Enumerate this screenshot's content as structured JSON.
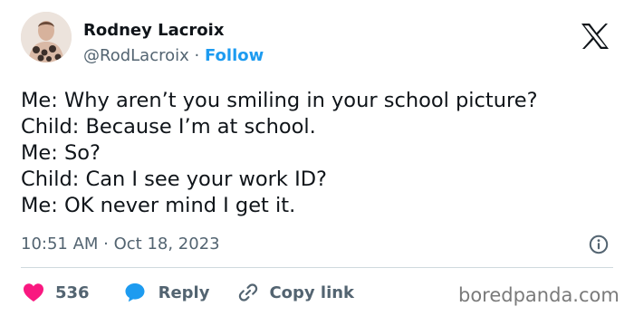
{
  "author": {
    "name": "Rodney Lacroix",
    "handle": "@RodLacroix",
    "separator": "·",
    "follow_label": "Follow"
  },
  "brand_icon": "x-logo-icon",
  "tweet": {
    "lines": [
      "Me: Why aren’t you smiling in your school picture?",
      "Child: Because I’m at school.",
      "Me: So?",
      "Child: Can I see your work ID?",
      "Me: OK never mind I get it."
    ],
    "timestamp": "10:51 AM · Oct 18, 2023"
  },
  "actions": {
    "like_count": "536",
    "reply_label": "Reply",
    "copy_link_label": "Copy link"
  },
  "watermark": "boredpanda.com",
  "colors": {
    "accent": "#1d9bf0",
    "like": "#f91880",
    "text": "#0f1419",
    "muted": "#536471"
  }
}
